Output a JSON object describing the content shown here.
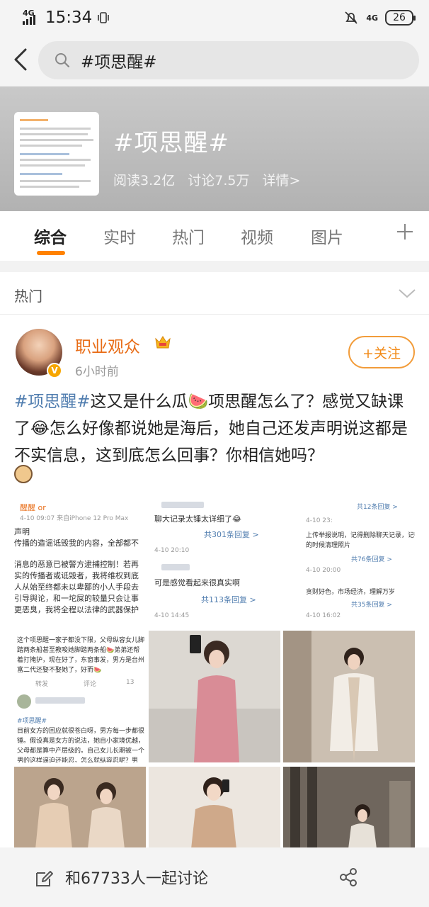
{
  "status_bar": {
    "network_left": "4G",
    "time": "15:34",
    "network_right": "4G",
    "battery": "26"
  },
  "search": {
    "query": "#项思醒#"
  },
  "topic": {
    "title": "#项思醒#",
    "reads": "阅读3.2亿",
    "discussions": "讨论7.5万",
    "details": "详情>"
  },
  "tabs": [
    {
      "label": "综合",
      "active": true
    },
    {
      "label": "实时",
      "active": false
    },
    {
      "label": "热门",
      "active": false
    },
    {
      "label": "视频",
      "active": false
    },
    {
      "label": "图片",
      "active": false
    }
  ],
  "section": {
    "label": "热门"
  },
  "post": {
    "username": "职业观众",
    "time": "6小时前",
    "follow_label": "+关注",
    "hashtag": "#项思醒#",
    "text_1": "这又是什么瓜🍉项思醒怎么了？感觉又缺课了😂怎么好像都说她是海后，她自己还发声明说这都是不实信息，这到底怎么回事？你相信她吗？",
    "images": {
      "img1": {
        "author": "醒醒 or",
        "meta": "4-10 09:07 来自iPhone 12 Pro Max",
        "lines": [
          "声明",
          "传播的造谣诋毁我的内容，全部都不",
          "",
          "消息的恶意已被警方逮捕控制！若再",
          "实的传播者或诋毁者，我将维权到底",
          "人从始至终都未以卑鄙的小人手段去",
          "引导舆论，和一坨屎的较量只会让事",
          "更恶臭，我将全程以法律的武器保护"
        ]
      },
      "img2": {
        "lines": [
          "聊大记录太锤太详细了😂",
          "共301条回复 >",
          "4-10 20:10",
          "可是感觉看起来很真实啊",
          "共113条回复 >",
          "4-10 14:45"
        ]
      },
      "img3": {
        "lines": [
          "共12条回复 >",
          "4-10 23:",
          "上传举报说明，记得删除聊天记录，记得秒撤",
          "的时候清理照片",
          "共76条回复 >",
          "4-10 20:00",
          "贪财好色，市场经济，理解万岁",
          "共35条回复 >",
          "4-10 16:02"
        ]
      },
      "img4": {
        "lines": [
          "这个项思醒一家子都没下限，父母纵容女儿脚",
          "踏两条船甚至教唆她脚踏两条船🍉弟弟还帮",
          "着打掩护，现在好了，东窗事发，男方是台州",
          "富二代还娶不娶她了，好而🍉",
          "转发",
          "评论",
          "13",
          "#项思醒#",
          "目前女方的回应就很苍白呀，男方每一步都很",
          "锤。假设真是女方的说法，她自小家境优越，",
          "父母都是算中产层级的。自己女儿长期被一个",
          "男的这样逼迫还能忍，怎么就纵容忍呢？男"
        ]
      }
    }
  },
  "bottom": {
    "discuss_label": "和67733人一起讨论"
  },
  "colors": {
    "accent_orange": "#ff8200",
    "username_orange": "#e86c16",
    "hashtag_blue": "#507daf"
  }
}
